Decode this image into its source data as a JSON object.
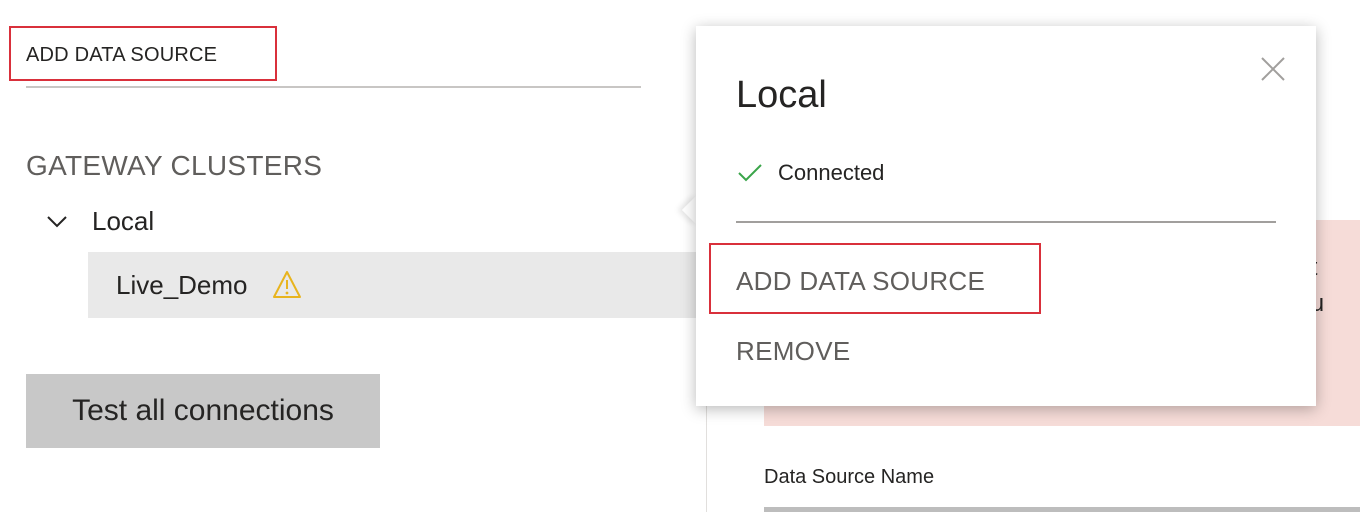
{
  "left_pane": {
    "add_data_source_label": "ADD DATA SOURCE",
    "gateway_clusters_heading": "GATEWAY CLUSTERS",
    "cluster": {
      "label": "Local",
      "expanded": true,
      "data_sources": [
        {
          "label": "Live_Demo",
          "status_icon": "warning-icon"
        }
      ]
    },
    "test_button_label": "Test all connections"
  },
  "popover": {
    "title": "Local",
    "status_icon": "check-icon",
    "status_text": "Connected",
    "menu": {
      "add_data_source": "ADD DATA SOURCE",
      "remove": "REMOVE"
    }
  },
  "right_pane": {
    "error_text_line1": "not",
    "error_text_line2": "bou",
    "data_source_name_label": "Data Source Name"
  },
  "colors": {
    "highlight_border": "#d9303b",
    "check_green": "#3aa54a",
    "warning_yellow": "#e8b41e",
    "error_banner": "#f6dcd8",
    "button_gray": "#c8c8c8",
    "selected_row": "#e9e9e9"
  }
}
